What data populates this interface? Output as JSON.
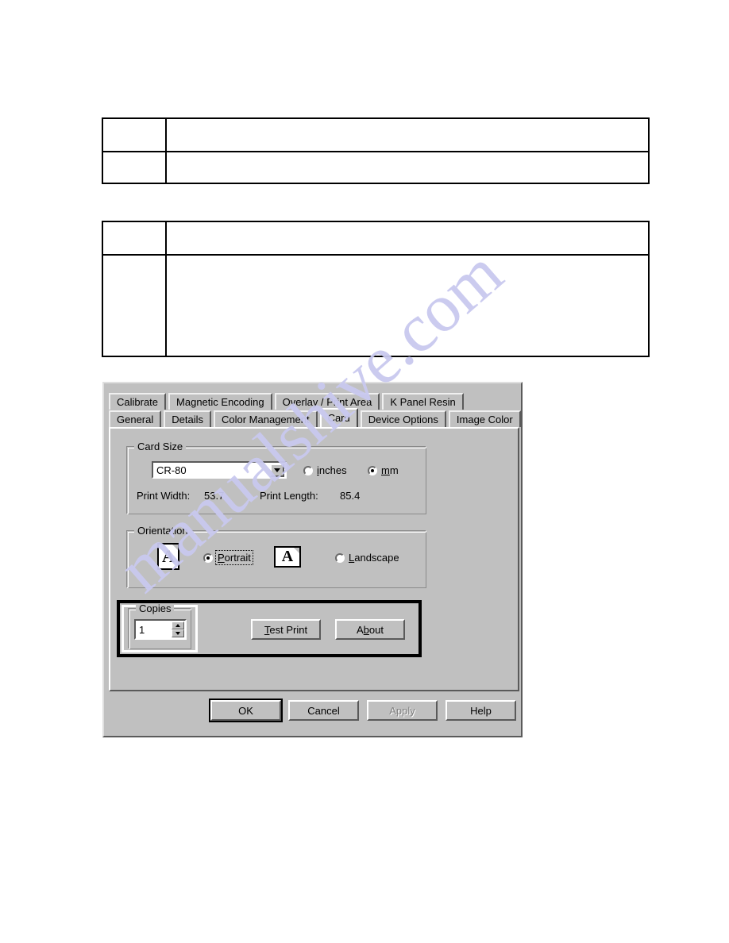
{
  "document": {
    "watermark_text": "manualshive.com",
    "watermark_color": "#c9c9ef",
    "tables": [
      {
        "name": "table-one",
        "rows": [
          {
            "narrow": "",
            "wide": ""
          },
          {
            "narrow": "",
            "wide": ""
          }
        ]
      },
      {
        "name": "table-two",
        "rows": [
          {
            "narrow": "",
            "wide": ""
          },
          {
            "narrow": "",
            "wide": ""
          }
        ]
      }
    ]
  },
  "dialog": {
    "background_color": "#c0c0c0",
    "tabs": {
      "row_top": [
        {
          "label": "Calibrate",
          "active": false
        },
        {
          "label": "Magnetic Encoding",
          "active": false
        },
        {
          "label": "Overlay / Print Area",
          "active": false
        },
        {
          "label": "K Panel Resin",
          "active": false
        }
      ],
      "row_bottom": [
        {
          "label": "General",
          "active": false
        },
        {
          "label": "Details",
          "active": false
        },
        {
          "label": "Color Management",
          "active": false
        },
        {
          "label": "Card",
          "active": true
        },
        {
          "label": "Device Options",
          "active": false
        },
        {
          "label": "Image Color",
          "active": false
        }
      ],
      "selected": "Card"
    },
    "card_size": {
      "group_title": "Card Size",
      "combo_value": "CR-80",
      "combo_arrow": "chevron-down-icon",
      "units": [
        {
          "label": "inches",
          "selected": false
        },
        {
          "label": "mm",
          "selected": true
        }
      ],
      "print_width_label": "Print Width:",
      "print_width_value": "53.7",
      "print_length_label": "Print Length:",
      "print_length_value": "85.4"
    },
    "orientation": {
      "group_title": "Orientation",
      "options": [
        {
          "label": "Portrait",
          "selected": true,
          "icon": "page-portrait-icon",
          "icon_glyph": "A",
          "focused": true
        },
        {
          "label": "Landscape",
          "selected": false,
          "icon": "page-landscape-icon",
          "icon_glyph": "A",
          "focused": false
        }
      ]
    },
    "copies": {
      "group_title": "Copies",
      "value": "1",
      "spin_up": "spinner-up-icon",
      "spin_down": "spinner-down-icon",
      "highlighted": true
    },
    "action_buttons": [
      {
        "label": "Test Print",
        "underline_index": 0,
        "enabled": true
      },
      {
        "label": "About",
        "underline_index": 1,
        "enabled": true
      }
    ],
    "footer_buttons": [
      {
        "label": "OK",
        "enabled": true,
        "is_default": true
      },
      {
        "label": "Cancel",
        "enabled": true,
        "is_default": false
      },
      {
        "label": "Apply",
        "enabled": false,
        "is_default": false
      },
      {
        "label": "Help",
        "enabled": true,
        "is_default": false
      }
    ]
  }
}
